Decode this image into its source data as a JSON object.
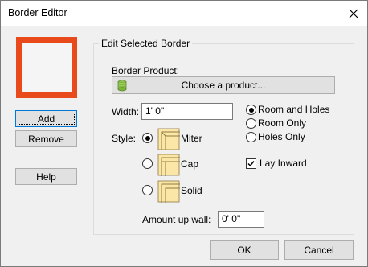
{
  "window": {
    "title": "Border Editor"
  },
  "left_panel": {
    "add_label": "Add",
    "remove_label": "Remove",
    "help_label": "Help",
    "preview_color": "#e84a1c"
  },
  "group": {
    "title": "Edit Selected Border",
    "border_product_label": "Border Product:",
    "choose_product_label": "Choose a product...",
    "width_label": "Width:",
    "width_value": "1' 0\"",
    "style_label": "Style:",
    "style_options": [
      {
        "label": "Miter",
        "selected": true
      },
      {
        "label": "Cap",
        "selected": false
      },
      {
        "label": "Solid",
        "selected": false
      }
    ],
    "placement_options": [
      {
        "label": "Room and Holes",
        "selected": true
      },
      {
        "label": "Room Only",
        "selected": false
      },
      {
        "label": "Holes Only",
        "selected": false
      }
    ],
    "lay_inward_label": "Lay Inward",
    "lay_inward_checked": true,
    "amount_up_wall_label": "Amount up wall:",
    "amount_up_wall_value": "0' 0\""
  },
  "footer": {
    "ok_label": "OK",
    "cancel_label": "Cancel"
  },
  "icons": {
    "close": "close-icon",
    "product": "product-stack-icon",
    "miter": "miter-style-icon",
    "cap": "cap-style-icon",
    "solid": "solid-style-icon"
  }
}
